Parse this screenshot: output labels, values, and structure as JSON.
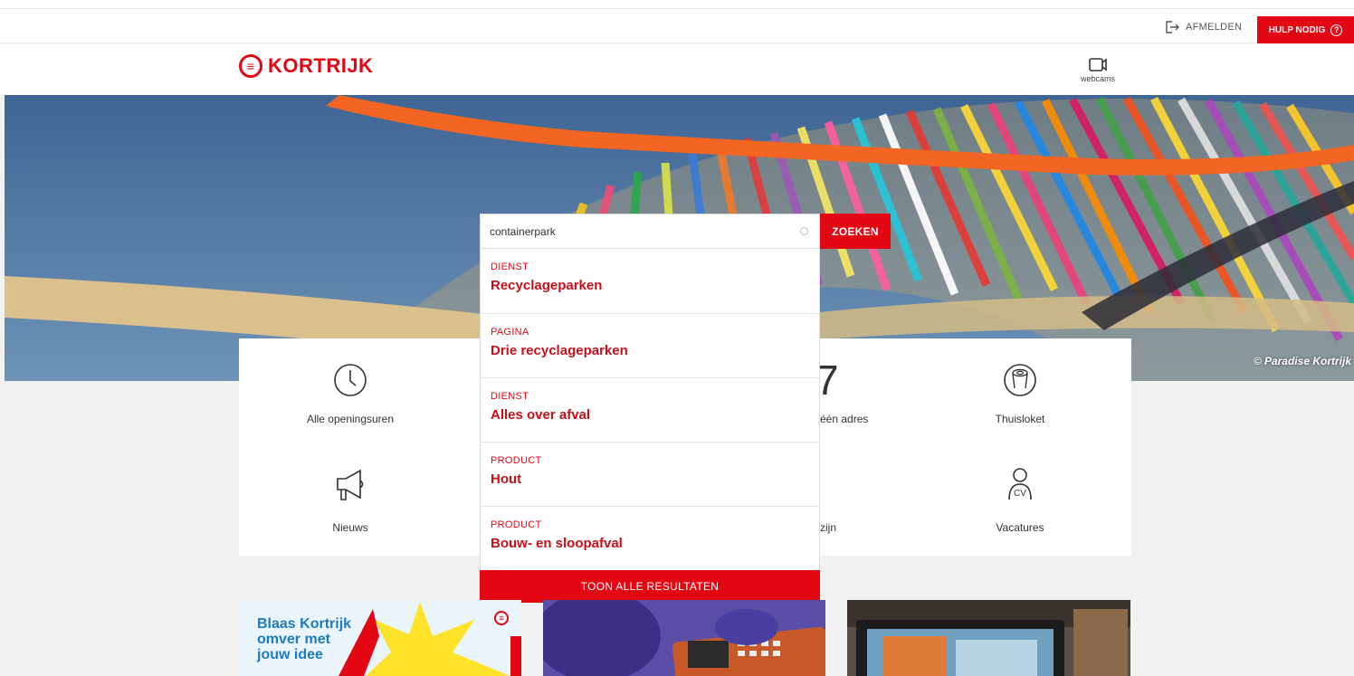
{
  "utility": {
    "logout_label": "AFMELDEN",
    "help_label": "HULP NODIG"
  },
  "header": {
    "logo_text": "KORTRIJK",
    "webcams_label": "webcams"
  },
  "hero": {
    "credit": "© Paradise Kortrijk"
  },
  "tiles": {
    "items": [
      {
        "label": "Alle openingsuren",
        "icon": "clock-icon"
      },
      {
        "label": "één adres",
        "icon": "number-seven-icon"
      },
      {
        "label": "Thuisloket",
        "icon": "thuisloket-icon"
      },
      {
        "label": "Nieuws",
        "icon": "megaphone-icon"
      },
      {
        "label": "zijn",
        "icon": ""
      },
      {
        "label": "Vacatures",
        "icon": "cv-person-icon"
      }
    ],
    "partial_number": "7"
  },
  "search": {
    "value": "containerpark",
    "button_label": "ZOEKEN",
    "results": [
      {
        "type": "DIENST",
        "title": "Recyclageparken"
      },
      {
        "type": "PAGINA",
        "title": "Drie recyclageparken"
      },
      {
        "type": "DIENST",
        "title": "Alles over afval"
      },
      {
        "type": "PRODUCT",
        "title": "Hout"
      },
      {
        "type": "PRODUCT",
        "title": "Bouw- en sloopafval"
      }
    ],
    "show_all_label": "TOON ALLE RESULTATEN"
  },
  "cards": {
    "first_lines": [
      "Blaas Kortrijk",
      "omver met",
      "jouw idee"
    ]
  },
  "colors": {
    "brand_red": "#e30613",
    "result_title_red": "#c4101a"
  }
}
